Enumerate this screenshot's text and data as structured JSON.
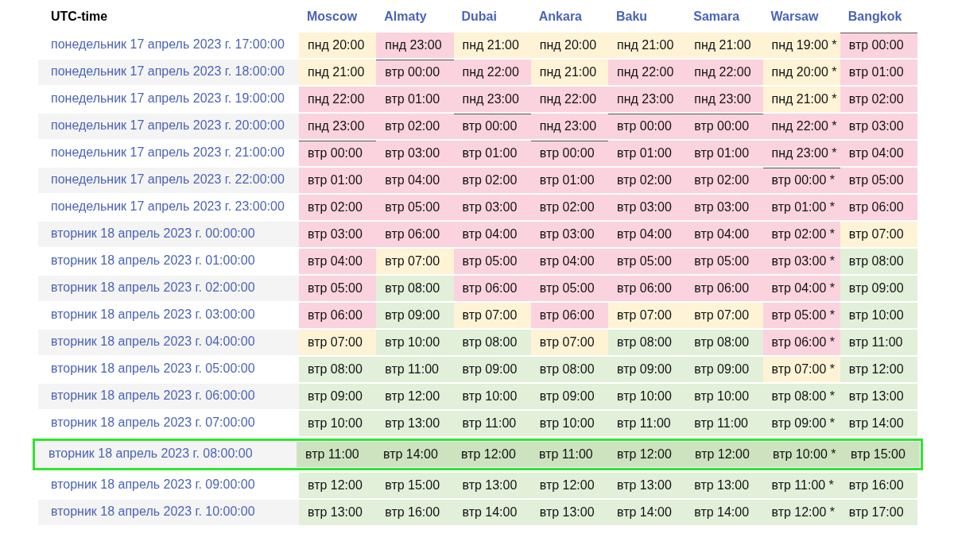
{
  "table": {
    "utc_header": "UTC-time",
    "cities": [
      "Moscow",
      "Almaty",
      "Dubai",
      "Ankara",
      "Baku",
      "Samara",
      "Warsaw",
      "Bangkok"
    ],
    "rows": [
      {
        "utc": "понедельник 17 апрель 2023 г. 17:00:00",
        "selected": false,
        "cells": [
          {
            "text": "пнд 20:00",
            "color": "#fff3d6",
            "day_start": false
          },
          {
            "text": "пнд 23:00",
            "color": "#fbd3df",
            "day_start": false
          },
          {
            "text": "пнд 21:00",
            "color": "#fff3d6",
            "day_start": false
          },
          {
            "text": "пнд 20:00",
            "color": "#fff3d6",
            "day_start": false
          },
          {
            "text": "пнд 21:00",
            "color": "#fff3d6",
            "day_start": false
          },
          {
            "text": "пнд 21:00",
            "color": "#fff3d6",
            "day_start": false
          },
          {
            "text": "пнд 19:00 *",
            "color": "#fff3d6",
            "day_start": false
          },
          {
            "text": "втр 00:00",
            "color": "#fbd3df",
            "day_start": true
          }
        ]
      },
      {
        "utc": "понедельник 17 апрель 2023 г. 18:00:00",
        "selected": false,
        "cells": [
          {
            "text": "пнд 21:00",
            "color": "#fff3d6",
            "day_start": false
          },
          {
            "text": "втр 00:00",
            "color": "#fbd3df",
            "day_start": true
          },
          {
            "text": "пнд 22:00",
            "color": "#fbd3df",
            "day_start": false
          },
          {
            "text": "пнд 21:00",
            "color": "#fff3d6",
            "day_start": false
          },
          {
            "text": "пнд 22:00",
            "color": "#fbd3df",
            "day_start": false
          },
          {
            "text": "пнд 22:00",
            "color": "#fbd3df",
            "day_start": false
          },
          {
            "text": "пнд 20:00 *",
            "color": "#fff3d6",
            "day_start": false
          },
          {
            "text": "втр 01:00",
            "color": "#fbd3df",
            "day_start": false
          }
        ]
      },
      {
        "utc": "понедельник 17 апрель 2023 г. 19:00:00",
        "selected": false,
        "cells": [
          {
            "text": "пнд 22:00",
            "color": "#fbd3df",
            "day_start": false
          },
          {
            "text": "втр 01:00",
            "color": "#fbd3df",
            "day_start": false
          },
          {
            "text": "пнд 23:00",
            "color": "#fbd3df",
            "day_start": false
          },
          {
            "text": "пнд 22:00",
            "color": "#fbd3df",
            "day_start": false
          },
          {
            "text": "пнд 23:00",
            "color": "#fbd3df",
            "day_start": false
          },
          {
            "text": "пнд 23:00",
            "color": "#fbd3df",
            "day_start": false
          },
          {
            "text": "пнд 21:00 *",
            "color": "#fff3d6",
            "day_start": false
          },
          {
            "text": "втр 02:00",
            "color": "#fbd3df",
            "day_start": false
          }
        ]
      },
      {
        "utc": "понедельник 17 апрель 2023 г. 20:00:00",
        "selected": false,
        "cells": [
          {
            "text": "пнд 23:00",
            "color": "#fbd3df",
            "day_start": false
          },
          {
            "text": "втр 02:00",
            "color": "#fbd3df",
            "day_start": false
          },
          {
            "text": "втр 00:00",
            "color": "#fbd3df",
            "day_start": true
          },
          {
            "text": "пнд 23:00",
            "color": "#fbd3df",
            "day_start": false
          },
          {
            "text": "втр 00:00",
            "color": "#fbd3df",
            "day_start": true
          },
          {
            "text": "втр 00:00",
            "color": "#fbd3df",
            "day_start": true
          },
          {
            "text": "пнд 22:00 *",
            "color": "#fbd3df",
            "day_start": false
          },
          {
            "text": "втр 03:00",
            "color": "#fbd3df",
            "day_start": false
          }
        ]
      },
      {
        "utc": "понедельник 17 апрель 2023 г. 21:00:00",
        "selected": false,
        "cells": [
          {
            "text": "втр 00:00",
            "color": "#fbd3df",
            "day_start": true
          },
          {
            "text": "втр 03:00",
            "color": "#fbd3df",
            "day_start": false
          },
          {
            "text": "втр 01:00",
            "color": "#fbd3df",
            "day_start": false
          },
          {
            "text": "втр 00:00",
            "color": "#fbd3df",
            "day_start": true
          },
          {
            "text": "втр 01:00",
            "color": "#fbd3df",
            "day_start": false
          },
          {
            "text": "втр 01:00",
            "color": "#fbd3df",
            "day_start": false
          },
          {
            "text": "пнд 23:00 *",
            "color": "#fbd3df",
            "day_start": false
          },
          {
            "text": "втр 04:00",
            "color": "#fbd3df",
            "day_start": false
          }
        ]
      },
      {
        "utc": "понедельник 17 апрель 2023 г. 22:00:00",
        "selected": false,
        "cells": [
          {
            "text": "втр 01:00",
            "color": "#fbd3df",
            "day_start": false
          },
          {
            "text": "втр 04:00",
            "color": "#fbd3df",
            "day_start": false
          },
          {
            "text": "втр 02:00",
            "color": "#fbd3df",
            "day_start": false
          },
          {
            "text": "втр 01:00",
            "color": "#fbd3df",
            "day_start": false
          },
          {
            "text": "втр 02:00",
            "color": "#fbd3df",
            "day_start": false
          },
          {
            "text": "втр 02:00",
            "color": "#fbd3df",
            "day_start": false
          },
          {
            "text": "втр 00:00 *",
            "color": "#fbd3df",
            "day_start": true
          },
          {
            "text": "втр 05:00",
            "color": "#fbd3df",
            "day_start": false
          }
        ]
      },
      {
        "utc": "понедельник 17 апрель 2023 г. 23:00:00",
        "selected": false,
        "cells": [
          {
            "text": "втр 02:00",
            "color": "#fbd3df",
            "day_start": false
          },
          {
            "text": "втр 05:00",
            "color": "#fbd3df",
            "day_start": false
          },
          {
            "text": "втр 03:00",
            "color": "#fbd3df",
            "day_start": false
          },
          {
            "text": "втр 02:00",
            "color": "#fbd3df",
            "day_start": false
          },
          {
            "text": "втр 03:00",
            "color": "#fbd3df",
            "day_start": false
          },
          {
            "text": "втр 03:00",
            "color": "#fbd3df",
            "day_start": false
          },
          {
            "text": "втр 01:00 *",
            "color": "#fbd3df",
            "day_start": false
          },
          {
            "text": "втр 06:00",
            "color": "#fbd3df",
            "day_start": false
          }
        ]
      },
      {
        "utc": "вторник 18 апрель 2023 г. 00:00:00",
        "selected": false,
        "cells": [
          {
            "text": "втр 03:00",
            "color": "#fbd3df",
            "day_start": false
          },
          {
            "text": "втр 06:00",
            "color": "#fbd3df",
            "day_start": false
          },
          {
            "text": "втр 04:00",
            "color": "#fbd3df",
            "day_start": false
          },
          {
            "text": "втр 03:00",
            "color": "#fbd3df",
            "day_start": false
          },
          {
            "text": "втр 04:00",
            "color": "#fbd3df",
            "day_start": false
          },
          {
            "text": "втр 04:00",
            "color": "#fbd3df",
            "day_start": false
          },
          {
            "text": "втр 02:00 *",
            "color": "#fbd3df",
            "day_start": false
          },
          {
            "text": "втр 07:00",
            "color": "#fff3d6",
            "day_start": false
          }
        ]
      },
      {
        "utc": "вторник 18 апрель 2023 г. 01:00:00",
        "selected": false,
        "cells": [
          {
            "text": "втр 04:00",
            "color": "#fbd3df",
            "day_start": false
          },
          {
            "text": "втр 07:00",
            "color": "#fff3d6",
            "day_start": false
          },
          {
            "text": "втр 05:00",
            "color": "#fbd3df",
            "day_start": false
          },
          {
            "text": "втр 04:00",
            "color": "#fbd3df",
            "day_start": false
          },
          {
            "text": "втр 05:00",
            "color": "#fbd3df",
            "day_start": false
          },
          {
            "text": "втр 05:00",
            "color": "#fbd3df",
            "day_start": false
          },
          {
            "text": "втр 03:00 *",
            "color": "#fbd3df",
            "day_start": false
          },
          {
            "text": "втр 08:00",
            "color": "#e2efd9",
            "day_start": false
          }
        ]
      },
      {
        "utc": "вторник 18 апрель 2023 г. 02:00:00",
        "selected": false,
        "cells": [
          {
            "text": "втр 05:00",
            "color": "#fbd3df",
            "day_start": false
          },
          {
            "text": "втр 08:00",
            "color": "#e2efd9",
            "day_start": false
          },
          {
            "text": "втр 06:00",
            "color": "#fbd3df",
            "day_start": false
          },
          {
            "text": "втр 05:00",
            "color": "#fbd3df",
            "day_start": false
          },
          {
            "text": "втр 06:00",
            "color": "#fbd3df",
            "day_start": false
          },
          {
            "text": "втр 06:00",
            "color": "#fbd3df",
            "day_start": false
          },
          {
            "text": "втр 04:00 *",
            "color": "#fbd3df",
            "day_start": false
          },
          {
            "text": "втр 09:00",
            "color": "#e2efd9",
            "day_start": false
          }
        ]
      },
      {
        "utc": "вторник 18 апрель 2023 г. 03:00:00",
        "selected": false,
        "cells": [
          {
            "text": "втр 06:00",
            "color": "#fbd3df",
            "day_start": false
          },
          {
            "text": "втр 09:00",
            "color": "#e2efd9",
            "day_start": false
          },
          {
            "text": "втр 07:00",
            "color": "#fff3d6",
            "day_start": false
          },
          {
            "text": "втр 06:00",
            "color": "#fbd3df",
            "day_start": false
          },
          {
            "text": "втр 07:00",
            "color": "#fff3d6",
            "day_start": false
          },
          {
            "text": "втр 07:00",
            "color": "#fff3d6",
            "day_start": false
          },
          {
            "text": "втр 05:00 *",
            "color": "#fbd3df",
            "day_start": false
          },
          {
            "text": "втр 10:00",
            "color": "#e2efd9",
            "day_start": false
          }
        ]
      },
      {
        "utc": "вторник 18 апрель 2023 г. 04:00:00",
        "selected": false,
        "cells": [
          {
            "text": "втр 07:00",
            "color": "#fff3d6",
            "day_start": false
          },
          {
            "text": "втр 10:00",
            "color": "#e2efd9",
            "day_start": false
          },
          {
            "text": "втр 08:00",
            "color": "#e2efd9",
            "day_start": false
          },
          {
            "text": "втр 07:00",
            "color": "#fff3d6",
            "day_start": false
          },
          {
            "text": "втр 08:00",
            "color": "#e2efd9",
            "day_start": false
          },
          {
            "text": "втр 08:00",
            "color": "#e2efd9",
            "day_start": false
          },
          {
            "text": "втр 06:00 *",
            "color": "#fbd3df",
            "day_start": false
          },
          {
            "text": "втр 11:00",
            "color": "#e2efd9",
            "day_start": false
          }
        ]
      },
      {
        "utc": "вторник 18 апрель 2023 г. 05:00:00",
        "selected": false,
        "cells": [
          {
            "text": "втр 08:00",
            "color": "#e2efd9",
            "day_start": false
          },
          {
            "text": "втр 11:00",
            "color": "#e2efd9",
            "day_start": false
          },
          {
            "text": "втр 09:00",
            "color": "#e2efd9",
            "day_start": false
          },
          {
            "text": "втр 08:00",
            "color": "#e2efd9",
            "day_start": false
          },
          {
            "text": "втр 09:00",
            "color": "#e2efd9",
            "day_start": false
          },
          {
            "text": "втр 09:00",
            "color": "#e2efd9",
            "day_start": false
          },
          {
            "text": "втр 07:00 *",
            "color": "#fff3d6",
            "day_start": false
          },
          {
            "text": "втр 12:00",
            "color": "#e2efd9",
            "day_start": false
          }
        ]
      },
      {
        "utc": "вторник 18 апрель 2023 г. 06:00:00",
        "selected": false,
        "cells": [
          {
            "text": "втр 09:00",
            "color": "#e2efd9",
            "day_start": false
          },
          {
            "text": "втр 12:00",
            "color": "#e2efd9",
            "day_start": false
          },
          {
            "text": "втр 10:00",
            "color": "#e2efd9",
            "day_start": false
          },
          {
            "text": "втр 09:00",
            "color": "#e2efd9",
            "day_start": false
          },
          {
            "text": "втр 10:00",
            "color": "#e2efd9",
            "day_start": false
          },
          {
            "text": "втр 10:00",
            "color": "#e2efd9",
            "day_start": false
          },
          {
            "text": "втр 08:00 *",
            "color": "#e2efd9",
            "day_start": false
          },
          {
            "text": "втр 13:00",
            "color": "#e2efd9",
            "day_start": false
          }
        ]
      },
      {
        "utc": "вторник 18 апрель 2023 г. 07:00:00",
        "selected": false,
        "cells": [
          {
            "text": "втр 10:00",
            "color": "#e2efd9",
            "day_start": false
          },
          {
            "text": "втр 13:00",
            "color": "#e2efd9",
            "day_start": false
          },
          {
            "text": "втр 11:00",
            "color": "#e2efd9",
            "day_start": false
          },
          {
            "text": "втр 10:00",
            "color": "#e2efd9",
            "day_start": false
          },
          {
            "text": "втр 11:00",
            "color": "#e2efd9",
            "day_start": false
          },
          {
            "text": "втр 11:00",
            "color": "#e2efd9",
            "day_start": false
          },
          {
            "text": "втр 09:00 *",
            "color": "#e2efd9",
            "day_start": false
          },
          {
            "text": "втр 14:00",
            "color": "#e2efd9",
            "day_start": false
          }
        ]
      },
      {
        "utc": "вторник 18 апрель 2023 г. 08:00:00",
        "selected": true,
        "cells": [
          {
            "text": "втр 11:00",
            "color": "#cde3bf",
            "day_start": false
          },
          {
            "text": "втр 14:00",
            "color": "#cde3bf",
            "day_start": false
          },
          {
            "text": "втр 12:00",
            "color": "#cde3bf",
            "day_start": false
          },
          {
            "text": "втр 11:00",
            "color": "#cde3bf",
            "day_start": false
          },
          {
            "text": "втр 12:00",
            "color": "#cde3bf",
            "day_start": false
          },
          {
            "text": "втр 12:00",
            "color": "#cde3bf",
            "day_start": false
          },
          {
            "text": "втр 10:00 *",
            "color": "#cde3bf",
            "day_start": false
          },
          {
            "text": "втр 15:00",
            "color": "#cde3bf",
            "day_start": false
          }
        ]
      },
      {
        "utc": "вторник 18 апрель 2023 г. 09:00:00",
        "selected": false,
        "cells": [
          {
            "text": "втр 12:00",
            "color": "#e2efd9",
            "day_start": false
          },
          {
            "text": "втр 15:00",
            "color": "#e2efd9",
            "day_start": false
          },
          {
            "text": "втр 13:00",
            "color": "#e2efd9",
            "day_start": false
          },
          {
            "text": "втр 12:00",
            "color": "#e2efd9",
            "day_start": false
          },
          {
            "text": "втр 13:00",
            "color": "#e2efd9",
            "day_start": false
          },
          {
            "text": "втр 13:00",
            "color": "#e2efd9",
            "day_start": false
          },
          {
            "text": "втр 11:00 *",
            "color": "#e2efd9",
            "day_start": false
          },
          {
            "text": "втр 16:00",
            "color": "#e2efd9",
            "day_start": false
          }
        ]
      },
      {
        "utc": "вторник 18 апрель 2023 г. 10:00:00",
        "selected": false,
        "cells": [
          {
            "text": "втр 13:00",
            "color": "#e2efd9",
            "day_start": false
          },
          {
            "text": "втр 16:00",
            "color": "#e2efd9",
            "day_start": false
          },
          {
            "text": "втр 14:00",
            "color": "#e2efd9",
            "day_start": false
          },
          {
            "text": "втр 13:00",
            "color": "#e2efd9",
            "day_start": false
          },
          {
            "text": "втр 14:00",
            "color": "#e2efd9",
            "day_start": false
          },
          {
            "text": "втр 14:00",
            "color": "#e2efd9",
            "day_start": false
          },
          {
            "text": "втр 12:00 *",
            "color": "#e2efd9",
            "day_start": false
          },
          {
            "text": "втр 17:00",
            "color": "#e2efd9",
            "day_start": false
          }
        ]
      }
    ]
  }
}
